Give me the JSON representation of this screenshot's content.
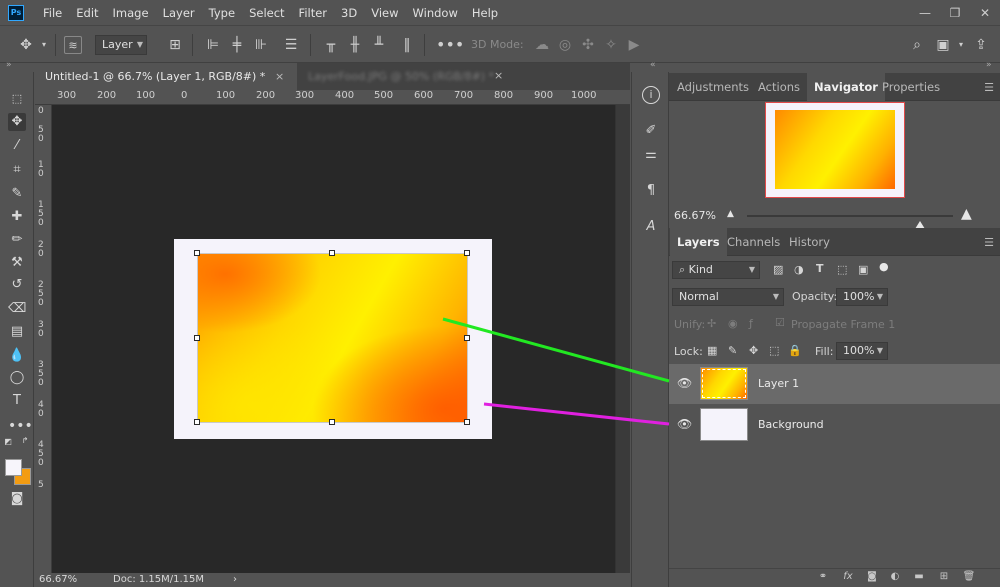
{
  "app": {
    "logo": "Ps",
    "window_controls": [
      "—",
      "❐",
      "✕"
    ]
  },
  "menu": [
    "File",
    "Edit",
    "Image",
    "Layer",
    "Type",
    "Select",
    "Filter",
    "3D",
    "View",
    "Window",
    "Help"
  ],
  "options_bar": {
    "auto_select_value": "Layer",
    "mode_3d_label": "3D Mode:",
    "icons": [
      "move-icon",
      "stack-icon",
      "grid-icon",
      "align-left-icon",
      "align-center-icon",
      "align-right-icon",
      "align-vcenter-icon",
      "distribute-top-icon",
      "distribute-middle-icon",
      "distribute-bottom-icon",
      "distribute-gap-icon",
      "more-icon",
      "orbit-3d-icon",
      "roll-3d-icon",
      "pan-3d-icon",
      "slide-3d-icon",
      "camera-3d-icon",
      "search-icon",
      "workspace-icon",
      "share-icon"
    ]
  },
  "document_tabs": [
    {
      "label": "Untitled-1 @ 66.7% (Layer 1, RGB/8#) *",
      "close": "×",
      "active": true
    },
    {
      "label": "LayerFood.JPG @ 50% (RGB/8#) *",
      "close": "×",
      "active": false
    }
  ],
  "ruler_h": [
    "300",
    "200",
    "100",
    "0",
    "100",
    "200",
    "300",
    "400",
    "500",
    "600",
    "700",
    "800",
    "900",
    "1000"
  ],
  "ruler_v": [
    "0",
    "5",
    "0",
    "1",
    "0",
    "1",
    "5",
    "0",
    "2",
    "0",
    "2",
    "5",
    "0",
    "3",
    "0",
    "3",
    "5",
    "0",
    "4",
    "0",
    "4",
    "5",
    "0",
    "5"
  ],
  "status": {
    "zoom": "66.67%",
    "doc_info": "Doc: 1.15M/1.15M",
    "arrow": "›"
  },
  "panel_top": {
    "tabs": [
      "Adjustments",
      "Actions",
      "Navigator",
      "Properties"
    ],
    "active_tab": "Navigator",
    "zoom_value": "66.67%"
  },
  "panel_layers": {
    "tabs": [
      "Layers",
      "Channels",
      "History"
    ],
    "active_tab": "Layers",
    "filter_kind": "Kind",
    "blend_mode": "Normal",
    "opacity_label": "Opacity:",
    "opacity_value": "100%",
    "unify_label": "Unify:",
    "propagate_label": "Propagate Frame 1",
    "lock_label": "Lock:",
    "fill_label": "Fill:",
    "fill_value": "100%",
    "layers": [
      {
        "name": "Layer 1",
        "selected": true
      },
      {
        "name": "Background",
        "selected": false
      }
    ]
  },
  "colors": {
    "foreground": "#f7f5fb",
    "background": "#f39c12",
    "arrow_green": "#22e822",
    "arrow_magenta": "#e020e0"
  }
}
